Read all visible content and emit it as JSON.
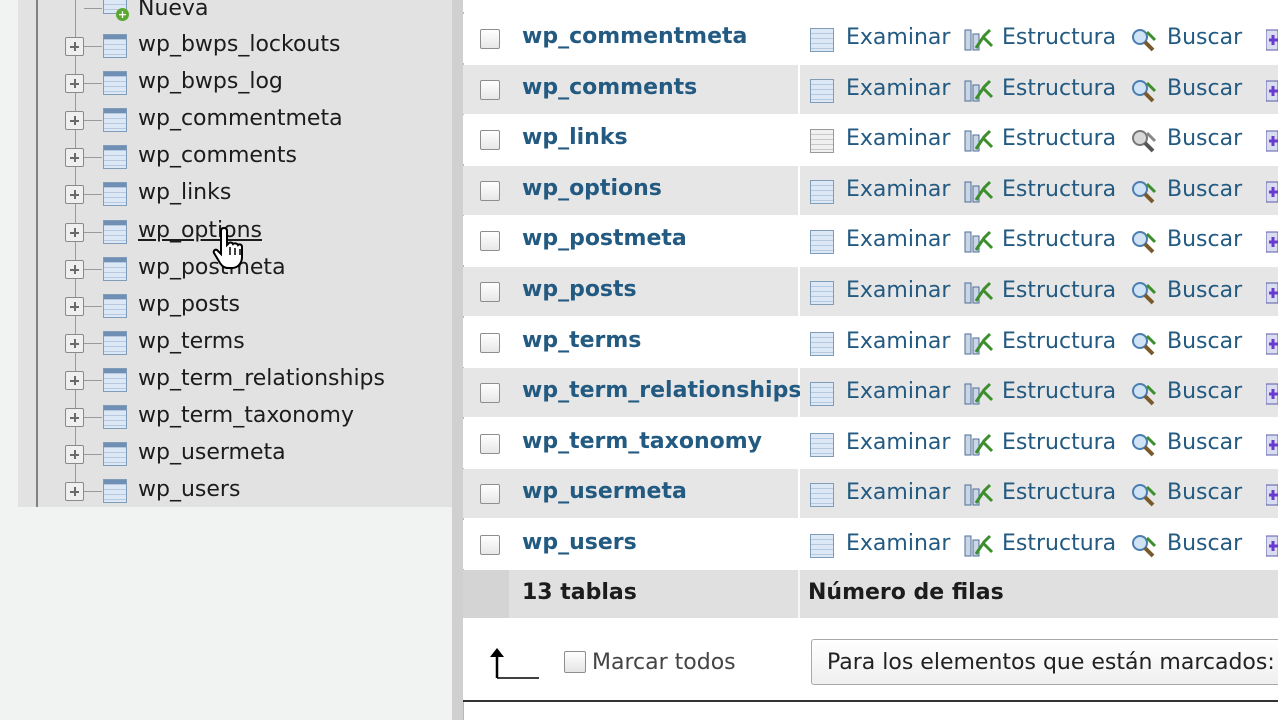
{
  "nav": {
    "new_label": "Nueva",
    "tables": [
      {
        "label": "wp_bwps_lockouts"
      },
      {
        "label": "wp_bwps_log"
      },
      {
        "label": "wp_commentmeta"
      },
      {
        "label": "wp_comments"
      },
      {
        "label": "wp_links"
      },
      {
        "label": "wp_options"
      },
      {
        "label": "wp_postmeta"
      },
      {
        "label": "wp_posts"
      },
      {
        "label": "wp_terms"
      },
      {
        "label": "wp_term_relationships"
      },
      {
        "label": "wp_term_taxonomy"
      },
      {
        "label": "wp_usermeta"
      },
      {
        "label": "wp_users"
      }
    ]
  },
  "actions": {
    "browse": "Examinar",
    "structure": "Estructura",
    "search": "Buscar"
  },
  "table_rows": [
    {
      "name": "wp_commentmeta"
    },
    {
      "name": "wp_comments"
    },
    {
      "name": "wp_links"
    },
    {
      "name": "wp_options"
    },
    {
      "name": "wp_postmeta"
    },
    {
      "name": "wp_posts"
    },
    {
      "name": "wp_terms"
    },
    {
      "name": "wp_term_relationships"
    },
    {
      "name": "wp_term_taxonomy"
    },
    {
      "name": "wp_usermeta"
    },
    {
      "name": "wp_users"
    }
  ],
  "footer": {
    "count_label": "13 tablas",
    "rows_label": "Número de filas"
  },
  "bulk": {
    "check_all_label": "Marcar todos",
    "with_selected_label": "Para los elementos que están marcados:"
  },
  "colors": {
    "link": "#235a81",
    "row_shade": "#e6e6e6",
    "nav_bg": "#e2e2e2"
  }
}
